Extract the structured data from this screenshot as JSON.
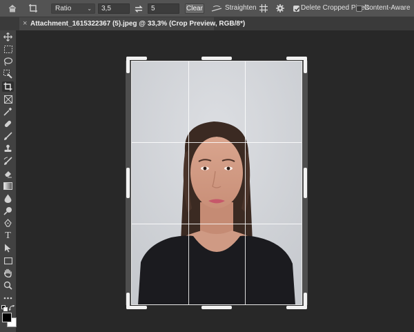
{
  "options_bar": {
    "home_icon": "home-icon",
    "crop_tool_icon": "crop-icon",
    "ratio_select": "Ratio",
    "width_value": "3,5",
    "swap_icon": "swap-arrows-icon",
    "height_value": "5",
    "clear_label": "Clear",
    "straighten_label": "Straighten",
    "grid_overlay_icon": "grid-overlay-icon",
    "settings_icon": "gear-icon",
    "delete_cropped_pixels_label": "Delete Cropped Pixels",
    "delete_cropped_pixels_checked": true,
    "content_aware_label": "Content-Aware",
    "content_aware_checked": false
  },
  "document_tab": {
    "close_glyph": "×",
    "title": "Attachment_1615322367 (5).jpeg @ 33,3% (Crop Preview, RGB/8*)"
  },
  "tools": [
    "move-icon",
    "marquee-icon",
    "lasso-icon",
    "quick-selection-icon",
    "crop-icon",
    "frame-icon",
    "eyedropper-icon",
    "healing-brush-icon",
    "brush-icon",
    "clone-stamp-icon",
    "history-brush-icon",
    "eraser-icon",
    "gradient-icon",
    "blur-icon",
    "dodge-icon",
    "pen-icon",
    "type-icon",
    "path-selection-icon",
    "rectangle-icon",
    "hand-icon",
    "zoom-icon",
    "more-tools-icon"
  ],
  "tool_labels": {
    "type": "T"
  },
  "colors": {
    "foreground": "#000000",
    "background": "#ffffff",
    "app_bg": "#282828",
    "options_bar": "#535353"
  }
}
